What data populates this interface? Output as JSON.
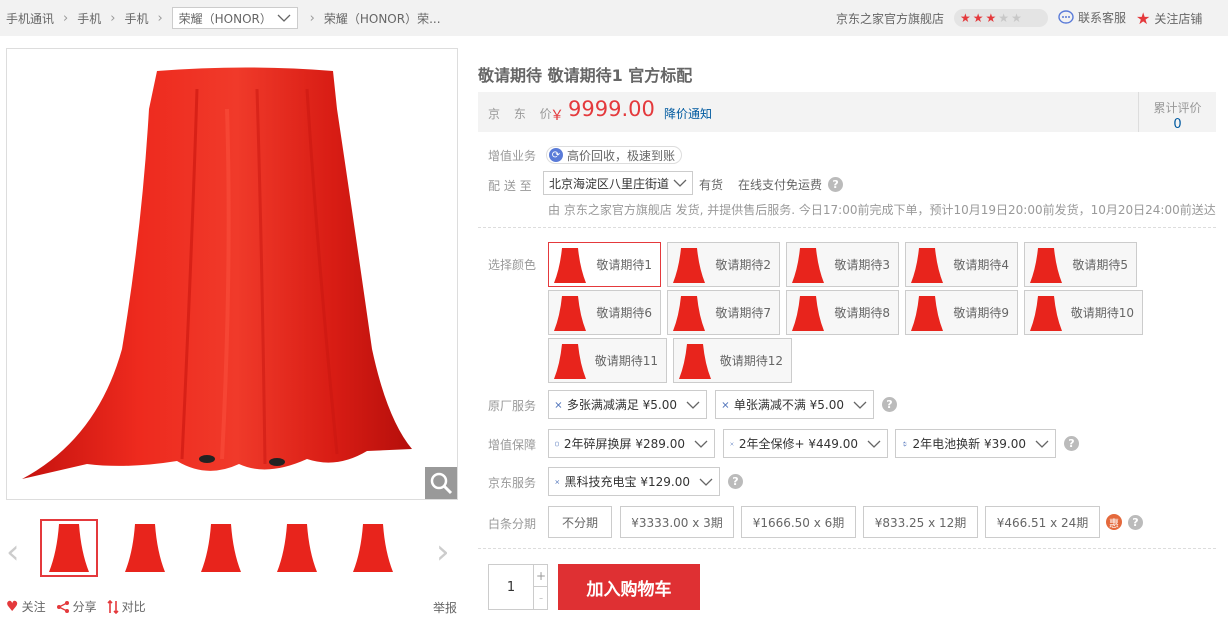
{
  "breadcrumb": {
    "items": [
      "手机通讯",
      "手机",
      "手机"
    ],
    "brand_select": "荣耀（HONOR）",
    "product": "荣耀（HONOR）荣...",
    "separator": "›"
  },
  "shop": {
    "name": "京东之家官方旗舰店",
    "rating": 3,
    "rating_max": 5,
    "service_label": "联系客服",
    "follow_label": "关注店铺"
  },
  "gallery": {
    "thumb_count": 5,
    "selected_thumb": 0,
    "links": {
      "follow": "关注",
      "share": "分享",
      "compare": "对比"
    },
    "report": "举报"
  },
  "product": {
    "title": "敬请期待 敬请期待1 官方标配",
    "price_label": "京 东 价",
    "currency": "￥",
    "price": "9999.00",
    "notify": "降价通知",
    "reviews_label": "累计评价",
    "reviews_count": "0"
  },
  "value_added": {
    "label": "增值业务",
    "pill_text": "高价回收，极速到账"
  },
  "delivery": {
    "label": "配 送 至",
    "address": "北京海淀区八里庄街道",
    "stock": "有货",
    "shipping": "在线支付免运费",
    "info": "由 京东之家官方旗舰店 发货, 并提供售后服务. 今日17:00前完成下单，预计10月19日20:00前发货，10月20日24:00前送达"
  },
  "colors": {
    "label": "选择颜色",
    "options": [
      "敬请期待1",
      "敬请期待2",
      "敬请期待3",
      "敬请期待4",
      "敬请期待5",
      "敬请期待6",
      "敬请期待7",
      "敬请期待8",
      "敬请期待9",
      "敬请期待10",
      "敬请期待11",
      "敬请期待12"
    ],
    "selected": 0
  },
  "factory_service": {
    "label": "原厂服务",
    "options": [
      "多张满减满足 ¥5.00",
      "单张满减不满 ¥5.00"
    ]
  },
  "warranty": {
    "label": "增值保障",
    "options": [
      "2年碎屏换屏 ¥289.00",
      "2年全保修+ ¥449.00",
      "2年电池换新 ¥39.00"
    ]
  },
  "jd_service": {
    "label": "京东服务",
    "options": [
      "黑科技充电宝 ¥129.00"
    ]
  },
  "installment": {
    "label": "白条分期",
    "options": [
      "不分期",
      "¥3333.00 x 3期",
      "¥1666.50 x 6期",
      "¥833.25 x 12期",
      "¥466.51 x 24期"
    ],
    "badge": "惠"
  },
  "purchase": {
    "quantity": "1",
    "plus": "+",
    "minus": "-",
    "cart_label": "加入购物车"
  },
  "colors_palette": {
    "accent": "#e4393c",
    "link": "#005aa0",
    "cloth": "#e8241c"
  }
}
